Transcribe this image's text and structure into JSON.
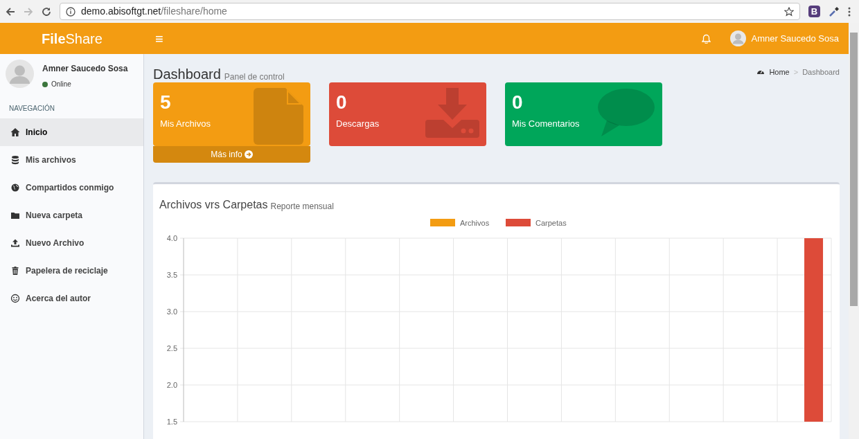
{
  "browser": {
    "url_host": "demo.abisoftgt.net",
    "url_path": "/fileshare/home",
    "extension_label": "B"
  },
  "header": {
    "logo_bold": "File",
    "logo_light": "Share",
    "menu_glyph": "≡",
    "user_name": "Amner Saucedo Sosa"
  },
  "sidebar": {
    "user_name": "Amner Saucedo Sosa",
    "status": "Online",
    "section_label": "NAVEGACIÓN",
    "items": [
      {
        "kind": "home",
        "label": "Inicio",
        "selected": true
      },
      {
        "kind": "database",
        "label": "Mis archivos",
        "selected": false
      },
      {
        "kind": "globe",
        "label": "Compartidos conmigo",
        "selected": false
      },
      {
        "kind": "folder",
        "label": "Nueva carpeta",
        "selected": false
      },
      {
        "kind": "upload",
        "label": "Nuevo Archivo",
        "selected": false
      },
      {
        "kind": "trash",
        "label": "Papelera de reciclaje",
        "selected": false
      },
      {
        "kind": "smile",
        "label": "Acerca del autor",
        "selected": false
      }
    ]
  },
  "page": {
    "title": "Dashboard",
    "subtitle": "Panel de control",
    "breadcrumb": [
      "Home",
      "Dashboard"
    ],
    "breadcrumb_separator": ">"
  },
  "stat_boxes": [
    {
      "kind": "file",
      "value": "5",
      "label": "Mis Archivos",
      "color": "#f39c12",
      "footer": "Más info"
    },
    {
      "kind": "download",
      "value": "0",
      "label": "Descargas",
      "color": "#dd4b39"
    },
    {
      "kind": "comment",
      "value": "0",
      "label": "Mis Comentarios",
      "color": "#00a65a"
    }
  ],
  "chart_panel": {
    "title": "Archivos vrs Carpetas",
    "subtitle": "Reporte mensual",
    "chart_data": {
      "type": "bar",
      "grid": true,
      "ylim": [
        1.5,
        4
      ],
      "yticks": [
        {
          "value": 4,
          "label": "4.0"
        },
        {
          "value": 3.5,
          "label": "3.5"
        },
        {
          "value": 3,
          "label": "3.0"
        },
        {
          "value": 2.5,
          "label": "2.5"
        },
        {
          "value": 2,
          "label": "2.0"
        },
        {
          "value": 1.5,
          "label": "1.5"
        }
      ],
      "series": [
        {
          "name": "Archivos",
          "color": "#f39c12",
          "values": [
            null,
            null,
            null,
            null,
            null,
            null,
            null,
            null,
            null,
            null,
            null,
            null
          ]
        },
        {
          "name": "Carpetas",
          "color": "#dd4b39",
          "values": [
            null,
            null,
            null,
            null,
            null,
            null,
            null,
            null,
            null,
            null,
            null,
            4
          ]
        }
      ]
    }
  }
}
